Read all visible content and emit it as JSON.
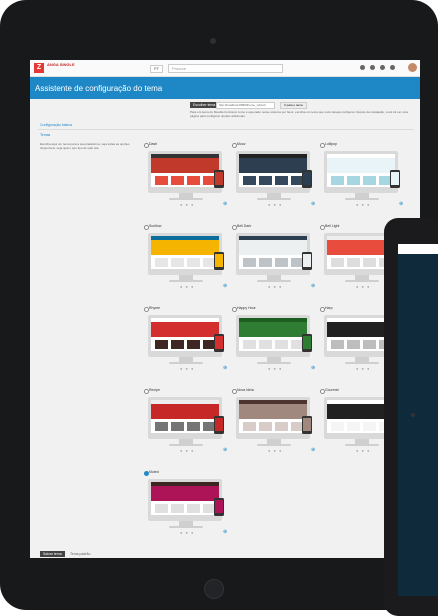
{
  "app": {
    "logo_text": "Z",
    "brand_text": "ANGA SINGLE",
    "lang": "PT",
    "search_placeholder": "Procure",
    "page_title": "Assistente de configuração do tema"
  },
  "help": {
    "button": "Escolher tema",
    "input_value": "http://localhost:8080/theme_wizard",
    "go": "Ir para o tema",
    "text": "Para um tema do Moodle funcionar como é esperado nesse sistema por favor, escolha um tema que você deseja configurar. Depois da instalação, você irá ver uma página para configurar opções adicionais."
  },
  "sections": {
    "general": "Configuração básica",
    "themes": "Temas"
  },
  "side_text": "Escolha aqui um tema para a sua plataforma, veja todas as opções disponíveis, seja qual o seu tipo de web site.",
  "themes": [
    {
      "name": "Dash",
      "selected": false
    },
    {
      "name": "Moov",
      "selected": false
    },
    {
      "name": "Lollipop",
      "selected": false
    },
    {
      "name": "Sunflow",
      "selected": false
    },
    {
      "name": "Bell Dark",
      "selected": false
    },
    {
      "name": "Bell Light",
      "selected": false
    },
    {
      "name": "Rhyme",
      "selected": false
    },
    {
      "name": "Happy Hour",
      "selected": false
    },
    {
      "name": "Harp",
      "selected": false
    },
    {
      "name": "Recipe",
      "selected": false
    },
    {
      "name": "Nova Ideia",
      "selected": false
    },
    {
      "name": "Gourmet",
      "selected": false
    },
    {
      "name": "Muted",
      "selected": true
    }
  ],
  "footer": {
    "save": "Salvar tema",
    "after": "Tema padrão"
  },
  "colors": {
    "accent": "#1e88c7",
    "brand": "#e53935"
  }
}
